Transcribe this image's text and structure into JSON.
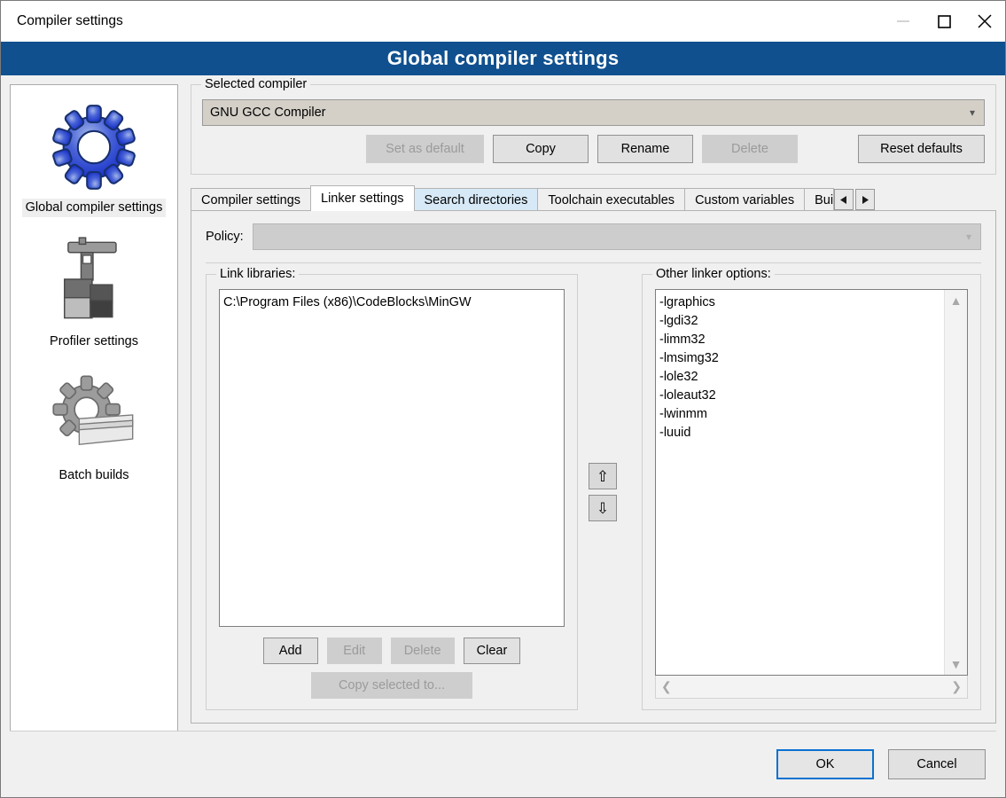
{
  "window": {
    "title": "Compiler settings",
    "minimize_icon": "minimize-icon",
    "maximize_icon": "maximize-icon",
    "close_icon": "close-icon"
  },
  "banner": {
    "title": "Global compiler settings",
    "color": "#10508f"
  },
  "sidebar": {
    "items": [
      {
        "label": "Global compiler settings",
        "icon": "blue-gear-icon",
        "selected": true
      },
      {
        "label": "Profiler settings",
        "icon": "clamp-vise-icon",
        "selected": false
      },
      {
        "label": "Batch builds",
        "icon": "gear-documents-icon",
        "selected": false
      }
    ]
  },
  "selected_compiler": {
    "legend": "Selected compiler",
    "value": "GNU GCC Compiler",
    "dropdown_icon": "chevron-down-icon",
    "buttons": [
      {
        "label": "Set as default",
        "enabled": false
      },
      {
        "label": "Copy",
        "enabled": true
      },
      {
        "label": "Rename",
        "enabled": true
      },
      {
        "label": "Delete",
        "enabled": false
      },
      {
        "label": "Reset defaults",
        "enabled": true
      }
    ]
  },
  "tabs": {
    "items": [
      {
        "label": "Compiler settings",
        "state": "normal"
      },
      {
        "label": "Linker settings",
        "state": "active"
      },
      {
        "label": "Search directories",
        "state": "hover"
      },
      {
        "label": "Toolchain executables",
        "state": "normal"
      },
      {
        "label": "Custom variables",
        "state": "normal"
      },
      {
        "label": "Bui",
        "state": "clipped"
      }
    ],
    "scroll_left_icon": "triangle-left-icon",
    "scroll_right_icon": "triangle-right-icon"
  },
  "policy": {
    "label": "Policy:",
    "value": "",
    "enabled": false,
    "dropdown_icon": "chevron-down-icon"
  },
  "link_libraries": {
    "legend": "Link libraries:",
    "items": [
      "C:\\Program Files (x86)\\CodeBlocks\\MinGW"
    ],
    "buttons": [
      {
        "label": "Add",
        "enabled": true
      },
      {
        "label": "Edit",
        "enabled": false
      },
      {
        "label": "Delete",
        "enabled": false
      },
      {
        "label": "Clear",
        "enabled": true
      }
    ],
    "copy_button": {
      "label": "Copy selected to...",
      "enabled": false
    }
  },
  "reorder": {
    "up_icon": "arrow-up-icon",
    "up_glyph": "⇧",
    "down_icon": "arrow-down-icon",
    "down_glyph": "⇩"
  },
  "other_linker_options": {
    "legend": "Other linker options:",
    "items": [
      "-lgraphics",
      "-lgdi32",
      "-limm32",
      "-lmsimg32",
      "-lole32",
      "-loleaut32",
      "-lwinmm",
      "-luuid"
    ],
    "scroll_up_icon": "chevron-up-icon",
    "scroll_down_icon": "chevron-down-icon",
    "scroll_left_icon": "chevron-left-icon",
    "scroll_right_icon": "chevron-right-icon"
  },
  "footer": {
    "ok_label": "OK",
    "cancel_label": "Cancel",
    "focus_color": "#0a72d0"
  }
}
